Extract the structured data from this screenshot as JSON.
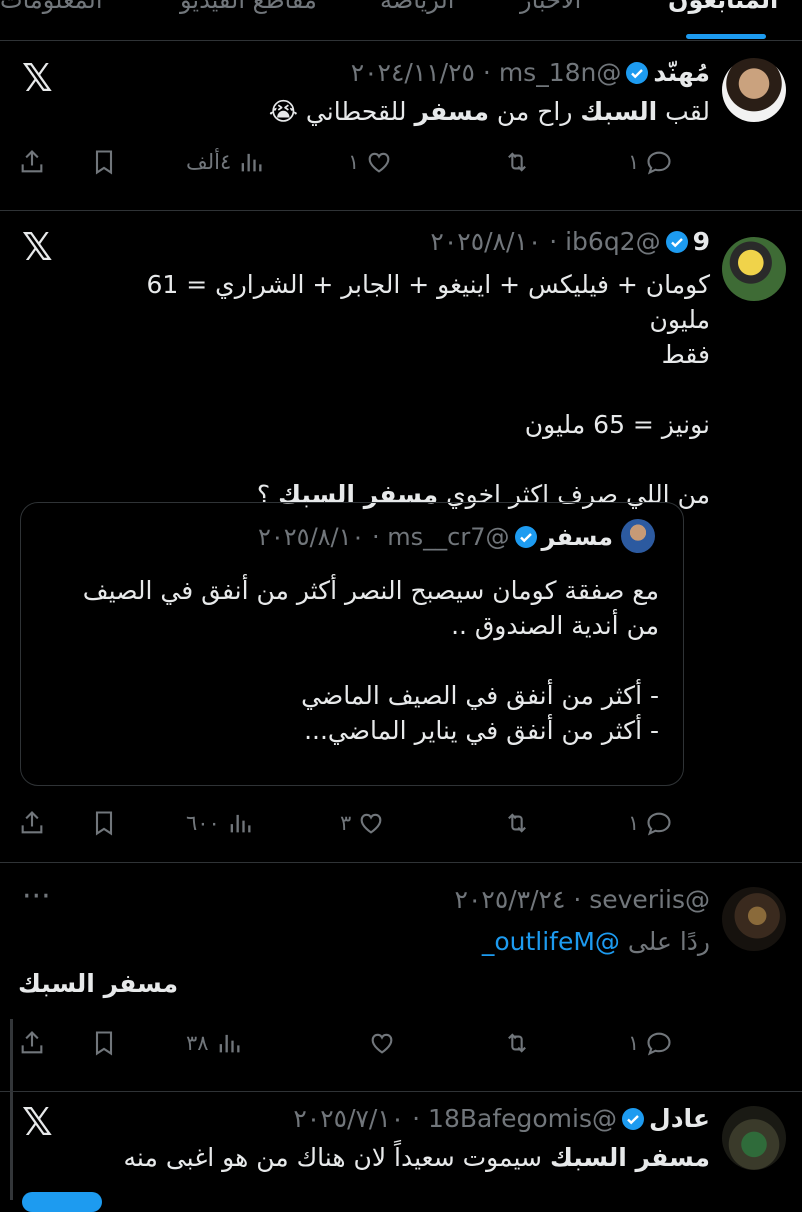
{
  "tabs": [
    "المتابعون",
    "الأخبار",
    "الرياضة",
    "مقاطع الفيديو",
    "المعلومات"
  ],
  "tweets": [
    {
      "name": "مُهنّد",
      "handle": "@ms_18n",
      "date": "٢٠٢٤/١١/٢٥",
      "text_pre": "لقب ",
      "text_b1": "السبك",
      "text_mid": " راح من ",
      "text_b2": "مسفر",
      "text_post": " للقحطاني 😭",
      "replies": "١",
      "reposts": "",
      "likes": "١",
      "views": "٤ألف"
    },
    {
      "name": "9",
      "handle": "@ib6q2",
      "date": "٢٠٢٥/٨/١٠",
      "line1": "كومان + فيليكس + اينيغو + الجابر + الشراري = 61 مليون",
      "line2": "فقط",
      "line3": "نونيز = 65 مليون",
      "line4_pre": "من اللي صرف اكثر اخوي ",
      "line4_b": "مسفر السبك",
      "line4_post": " ؟",
      "quote": {
        "name": "مسفر",
        "handle": "@ms__cr7",
        "date": "٢٠٢٥/٨/١٠",
        "line1": "مع صفقة كومان سيصبح النصر أكثر من أنفق في الصيف",
        "line2": "من أندية الصندوق ..",
        "line3": "- أكثر من أنفق في الصيف الماضي",
        "line4": "- أكثر من أنفق في يناير الماضي..."
      },
      "replies": "١",
      "reposts": "",
      "likes": "٣",
      "views": "٦٠٠"
    },
    {
      "name": "",
      "handle": "@severiis",
      "date": "٢٠٢٥/٣/٢٤",
      "reply_label": "ردًا على",
      "reply_to": "@outlifeM_",
      "text": "مسفر السبك",
      "replies": "١",
      "reposts": "",
      "likes": "",
      "views": "٣٨"
    },
    {
      "name": "عادل",
      "handle": "@18Bafegomis",
      "date": "٢٠٢٥/٧/١٠",
      "text_b": "مسفر السبك",
      "text_post": " سيموت سعيداً لان هناك من هو اغبى منه"
    }
  ],
  "colors": {
    "accent": "#1d9bf0",
    "muted": "#71767b",
    "border": "#2f3336"
  },
  "icons": [
    "x-logo-icon",
    "verified-badge-icon",
    "reply-icon",
    "repost-icon",
    "like-icon",
    "views-icon",
    "bookmark-icon",
    "share-icon",
    "more-icon"
  ]
}
